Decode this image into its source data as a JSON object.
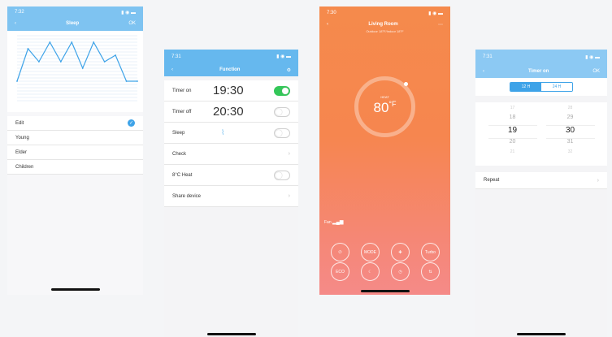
{
  "sleep_screen": {
    "status_time": "7:32",
    "title": "Sleep",
    "ok_label": "OK",
    "options": [
      {
        "label": "Edit",
        "selected": true
      },
      {
        "label": "Young",
        "selected": false
      },
      {
        "label": "Elder",
        "selected": false
      },
      {
        "label": "Children",
        "selected": false
      }
    ]
  },
  "function_screen": {
    "status_time": "7:31",
    "title": "Function",
    "timer_on": {
      "label": "Timer on",
      "value": "19:30",
      "enabled": true
    },
    "timer_off": {
      "label": "Timer off",
      "value": "20:30",
      "enabled": false
    },
    "sleep": {
      "label": "Sleep",
      "enabled": false
    },
    "check": {
      "label": "Check"
    },
    "heat": {
      "label": "8°C Heat",
      "enabled": false
    },
    "share": {
      "label": "Share device"
    }
  },
  "living_room_screen": {
    "status_time": "7:30",
    "title": "Living Room",
    "subtitle": "Outdoor 18°F/Indoor 18°F",
    "mode_label": "HEAT",
    "temperature": "80",
    "unit": "°F",
    "fan_label": "Fan",
    "buttons_row1": [
      "power-icon",
      "MODE",
      "fan-icon",
      "Turbo"
    ],
    "buttons_row2": [
      "ECO",
      "sleep-icon",
      "timer-icon",
      "swing-icon"
    ],
    "buttons_row2_text": [
      "ECO",
      "",
      "",
      ""
    ],
    "buttons_row1_text": [
      "",
      "MODE",
      "",
      "Turbo"
    ]
  },
  "timer_screen": {
    "status_time": "7:31",
    "title": "Timer on",
    "ok_label": "OK",
    "segments": [
      "12 H",
      "24 H"
    ],
    "hours": [
      "17",
      "18",
      "19",
      "20",
      "21"
    ],
    "minutes": [
      "28",
      "29",
      "30",
      "31",
      "32"
    ],
    "repeat_label": "Repeat"
  },
  "chart_data": {
    "type": "line",
    "x": [
      0,
      1,
      2,
      3,
      4,
      5,
      6,
      7,
      8,
      9,
      10,
      11
    ],
    "values": [
      16,
      26,
      22,
      28,
      22,
      28,
      20,
      28,
      22,
      24,
      16,
      16
    ],
    "ylim": [
      10,
      30
    ],
    "grid": true
  },
  "colors": {
    "accent": "#3ea3e8",
    "sleep_header": "#7ec3f1",
    "function_header": "#66b8ee",
    "timer_header": "#8cc9f3",
    "green": "#34c759",
    "orange_top": "#f58a4c",
    "orange_bottom": "#f58a88"
  }
}
